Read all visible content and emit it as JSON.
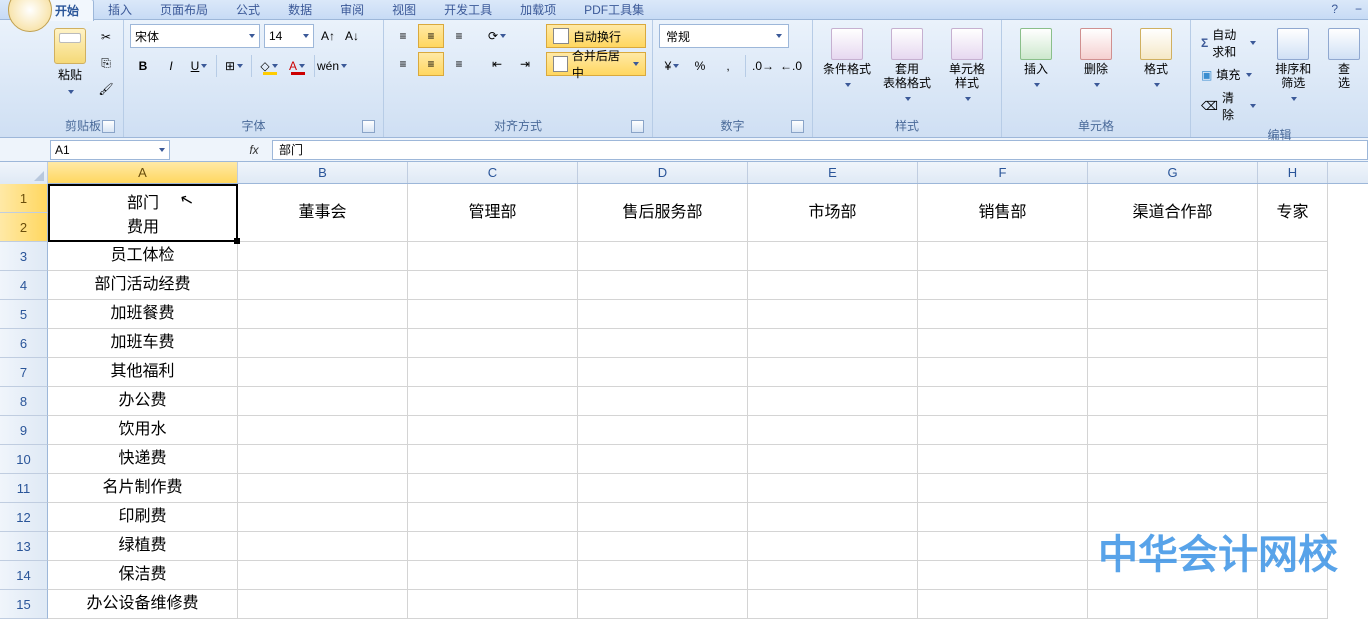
{
  "tabs": {
    "items": [
      "开始",
      "插入",
      "页面布局",
      "公式",
      "数据",
      "审阅",
      "视图",
      "开发工具",
      "加载项",
      "PDF工具集"
    ],
    "activeIndex": 0,
    "help": "?",
    "collapse": "−"
  },
  "ribbon": {
    "clipboard": {
      "paste": "粘贴",
      "label": "剪贴板"
    },
    "font": {
      "name": "宋体",
      "size": "14",
      "bold": "B",
      "italic": "I",
      "underline": "U",
      "label": "字体"
    },
    "align": {
      "wrap": "自动换行",
      "merge": "合并后居中",
      "label": "对齐方式"
    },
    "number": {
      "format": "常规",
      "label": "数字"
    },
    "styles": {
      "cond": "条件格式",
      "table": "套用\n表格格式",
      "cell": "单元格\n样式",
      "label": "样式"
    },
    "cells": {
      "insert": "插入",
      "delete": "删除",
      "format": "格式",
      "label": "单元格"
    },
    "editing": {
      "autosum": "自动求和",
      "fill": "填充",
      "clear": "清除",
      "sort": "排序和\n筛选",
      "find": "查\n选",
      "label": "编辑"
    }
  },
  "formula": {
    "cellRef": "A1",
    "fx": "fx",
    "value": "部门"
  },
  "columns": [
    "A",
    "B",
    "C",
    "D",
    "E",
    "F",
    "G",
    "H"
  ],
  "rowNums": [
    "1",
    "2",
    "3",
    "4",
    "5",
    "6",
    "7",
    "8",
    "9",
    "10",
    "11",
    "12",
    "13",
    "14",
    "15"
  ],
  "mergedA": {
    "line1": "部门",
    "line2": "费用"
  },
  "headerRow": [
    "董事会",
    "管理部",
    "售后服务部",
    "市场部",
    "销售部",
    "渠道合作部",
    "专家"
  ],
  "rowLabels": [
    "",
    "",
    "员工体检",
    "部门活动经费",
    "加班餐费",
    "加班车费",
    "其他福利",
    "办公费",
    "饮用水",
    "快递费",
    "名片制作费",
    "印刷费",
    "绿植费",
    "保洁费",
    "办公设备维修费"
  ],
  "watermark": "中华会计网校"
}
